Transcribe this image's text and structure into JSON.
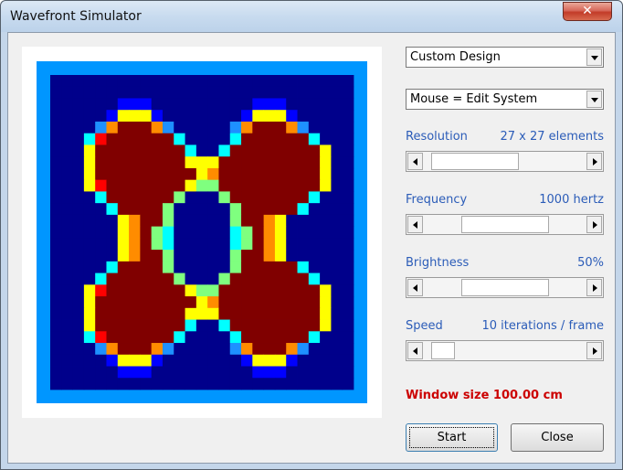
{
  "window": {
    "title": "Wavefront Simulator",
    "close_glyph": "✕"
  },
  "simulation": {
    "grid_size": 27,
    "legend": {
      "0": "#00008b",
      "1": "#0000ff",
      "2": "#1e90ff",
      "3": "#00ffff",
      "4": "#7fff7f",
      "5": "#ffff00",
      "6": "#ff8c00",
      "7": "#ff0000",
      "8": "#800000"
    },
    "border_color": "#0096ff",
    "rows": [
      "000000000000000000000000000",
      "000000000000000000000000000",
      "000000111000000000111000000",
      "000001555100000001555100000",
      "000026888620000026888620000",
      "000378888883000038888883000",
      "000588888888300388888888500",
      "000588888888555888888888500",
      "000588888888856888888888500",
      "000578888888544888888888500",
      "000038888884000488888883000",
      "000003888840000048888830000",
      "000000568840000048865000000",
      "000000568430000034865000000",
      "000000568430000034865000000",
      "000000568840000048865000000",
      "000003888840000048888830000",
      "000038888884000488888883000",
      "000578888888544888888888500",
      "000588888888856888888888500",
      "000588888888555888888888500",
      "000588888888300388888888500",
      "000378888883000038888883000",
      "000026888620000026888620000",
      "000001555100000001555100000",
      "000000111000000000111000000",
      "000000000000000000000000000"
    ]
  },
  "controls": {
    "design_select": "Custom Design",
    "mouse_select": "Mouse = Edit System",
    "resolution": {
      "label": "Resolution",
      "value": "27 x 27 elements",
      "level": 0.1
    },
    "frequency": {
      "label": "Frequency",
      "value": "1000 hertz",
      "level": 0.5
    },
    "brightness": {
      "label": "Brightness",
      "value": "50%",
      "level": 0.5
    },
    "speed": {
      "label": "Speed",
      "value": "10 iterations / frame",
      "level": 0.05
    }
  },
  "status_text": "Window size 100.00 cm",
  "buttons": {
    "start": "Start",
    "close": "Close"
  },
  "icons": {
    "combo_arrow": "chevron-down-icon",
    "scroll_left": "arrow-left-icon",
    "scroll_right": "arrow-right-icon"
  }
}
